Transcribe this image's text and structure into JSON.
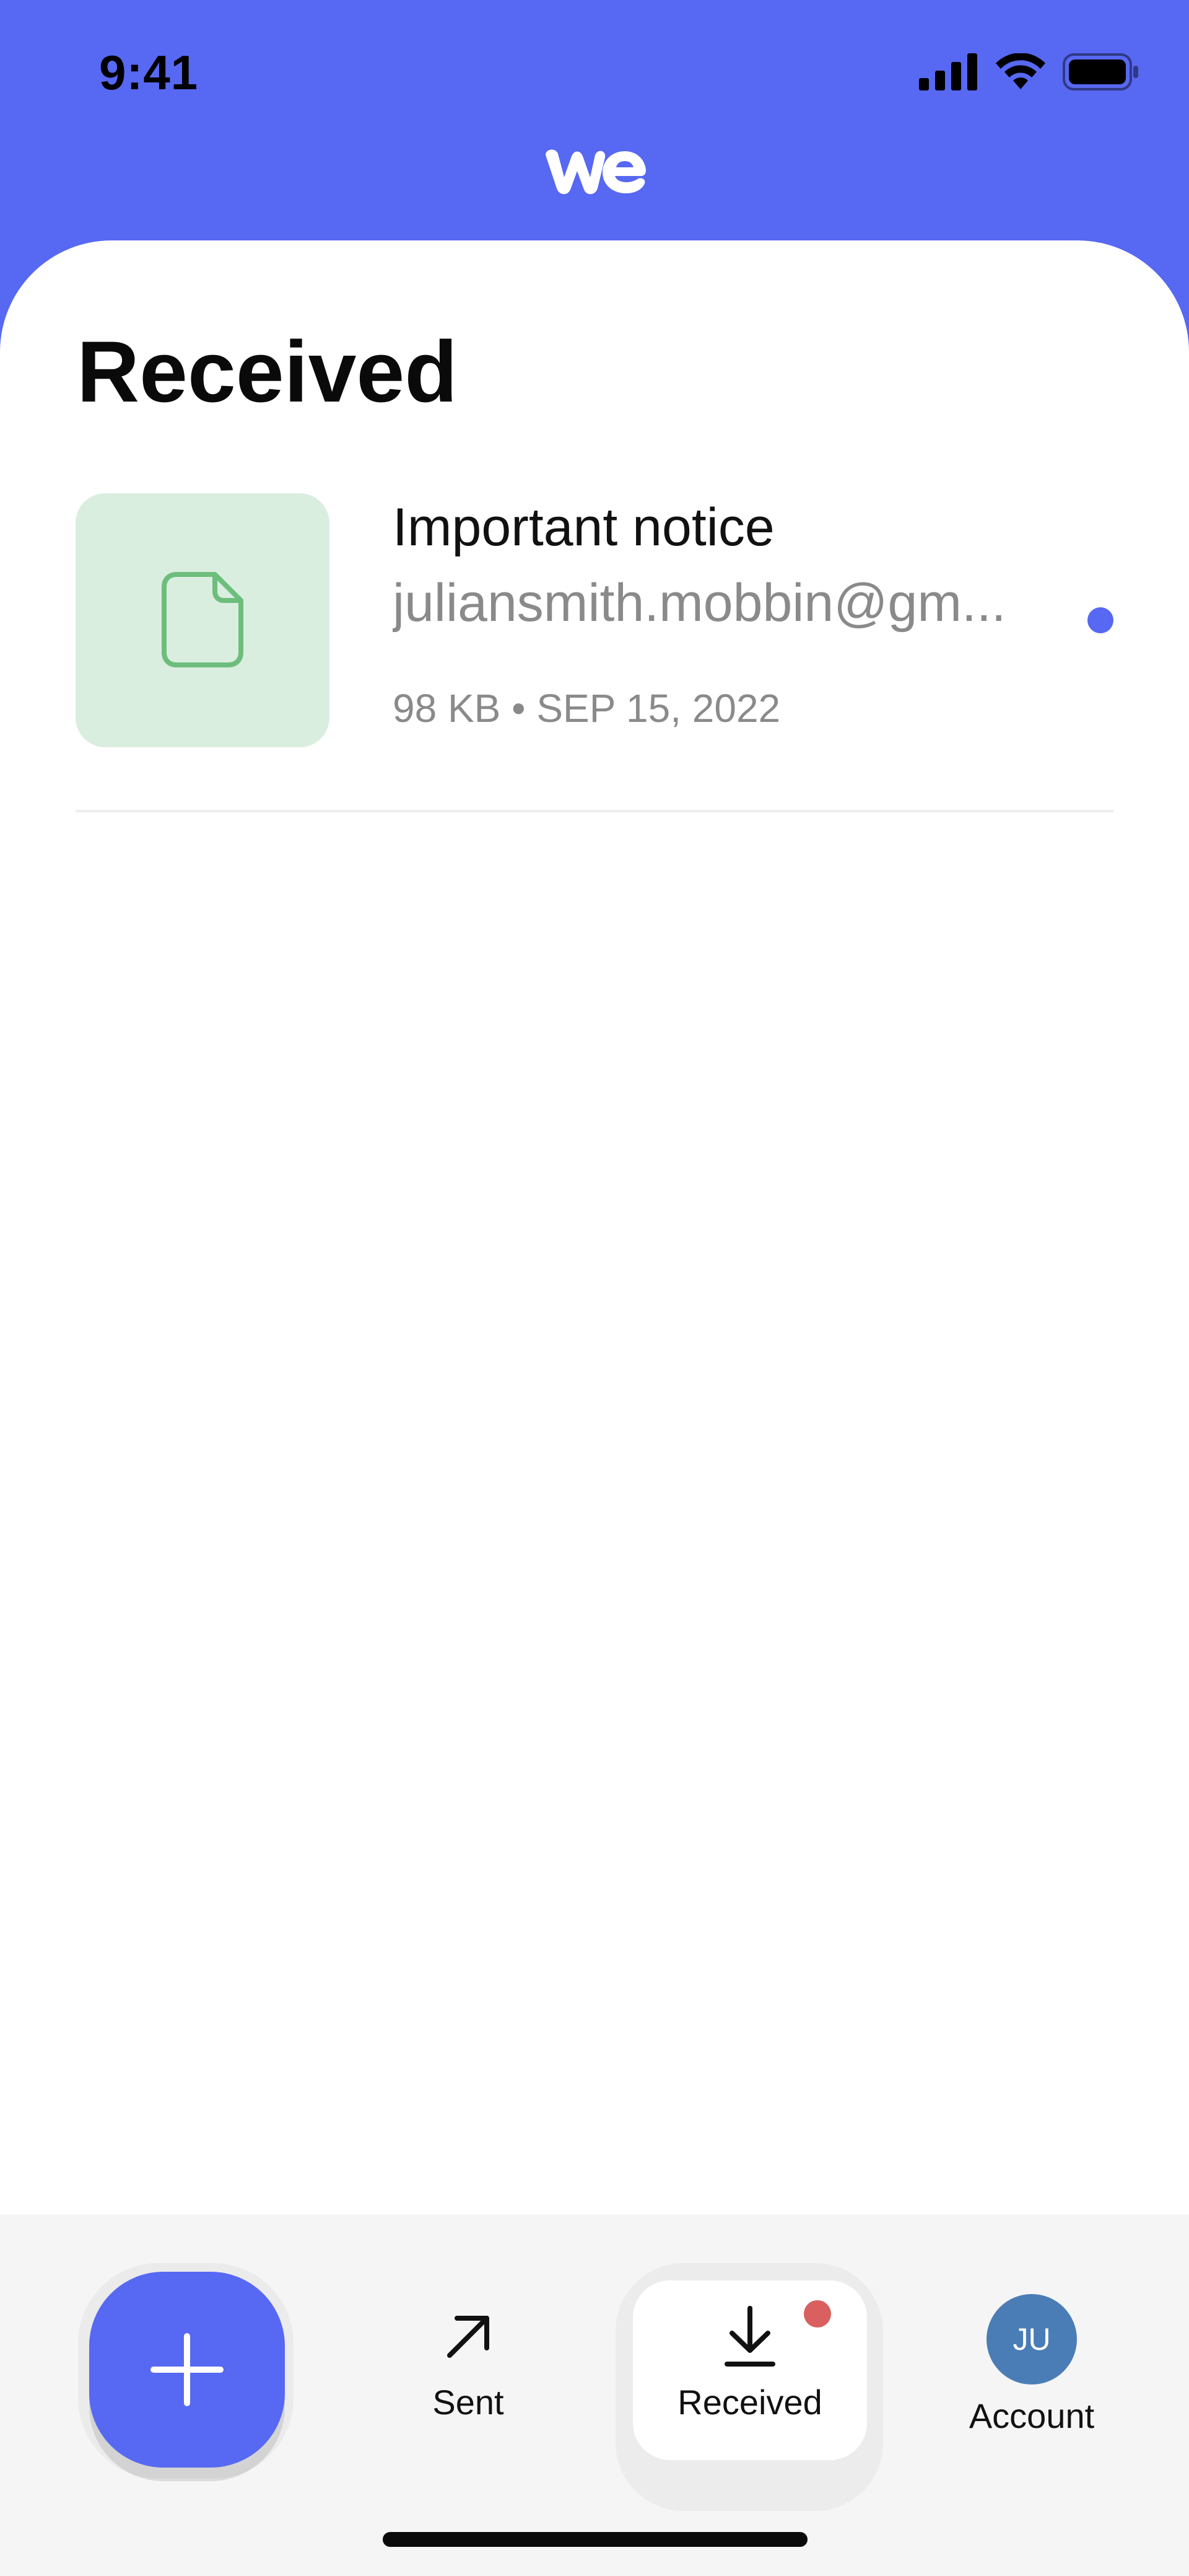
{
  "status_bar": {
    "time": "9:41"
  },
  "header": {
    "logo_alt": "we"
  },
  "page": {
    "title": "Received"
  },
  "transfers": [
    {
      "title": "Important notice",
      "sender": "juliansmith.mobbin@gm...",
      "size": "98 KB",
      "separator": "•",
      "date": "SEP 15, 2022",
      "unread": true,
      "icon": "file-icon"
    }
  ],
  "tab_bar": {
    "fab_icon": "plus-icon",
    "tabs": [
      {
        "label": "Sent",
        "icon": "arrow-up-right-icon"
      },
      {
        "label": "Received",
        "icon": "download-icon",
        "active": true,
        "has_badge": true
      },
      {
        "label": "Account",
        "avatar_initials": "JU"
      }
    ]
  },
  "colors": {
    "brand": "#5768F2",
    "thumb_bg": "#DAEEE0",
    "file_icon": "#6DBE7C",
    "badge": "#D9605E",
    "avatar": "#4A7DB5"
  }
}
